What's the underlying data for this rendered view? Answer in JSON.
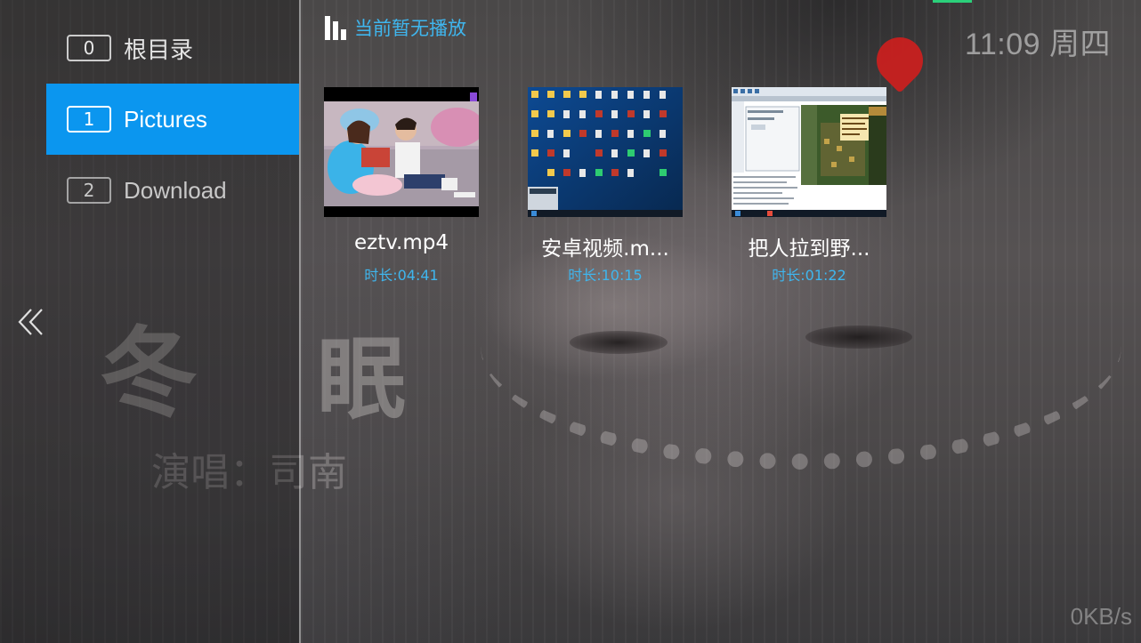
{
  "sidebar": {
    "items": [
      {
        "index": "0",
        "label": "根目录"
      },
      {
        "index": "1",
        "label": "Pictures"
      },
      {
        "index": "2",
        "label": "Download"
      }
    ]
  },
  "header": {
    "now_playing": "当前暂无播放",
    "clock": "11:09 周四"
  },
  "videos": [
    {
      "title": "eztv.mp4",
      "duration": "时长:04:41"
    },
    {
      "title": "安卓视频.m...",
      "duration": "时长:10:15"
    },
    {
      "title": "把人拉到野...",
      "duration": "时长:01:22"
    }
  ],
  "footer": {
    "speed": "0KB/s"
  },
  "background": {
    "title_chars": [
      "冬",
      "眠"
    ],
    "subtitle_chars": "演唱：司南"
  },
  "colors": {
    "accent": "#0b96ef",
    "link_text": "#3fb6ee"
  },
  "icons": {
    "now_playing": "equalizer-bars-icon",
    "back": "double-chevron-left-icon"
  }
}
